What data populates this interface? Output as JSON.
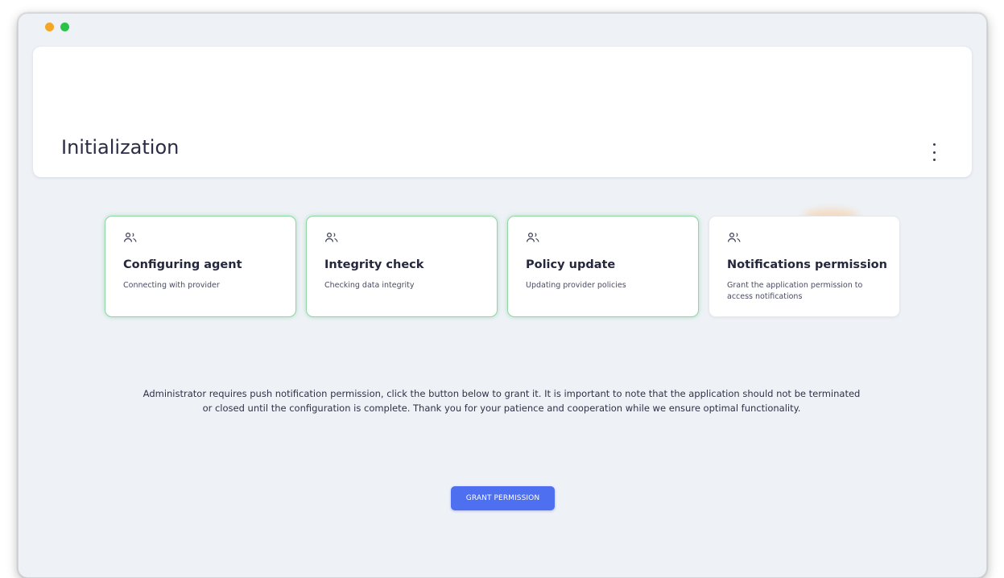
{
  "window": {
    "traffic_lights": [
      "#f5a623",
      "#2bc24a"
    ]
  },
  "header": {
    "title": "Initialization",
    "menu_icon": "kebab-menu-icon"
  },
  "steps": [
    {
      "title": "Configuring agent",
      "subtitle": "Connecting with provider",
      "status": "done",
      "icon": "users-icon"
    },
    {
      "title": "Integrity check",
      "subtitle": "Checking data integrity",
      "status": "done",
      "icon": "users-icon"
    },
    {
      "title": "Policy update",
      "subtitle": "Updating provider policies",
      "status": "done",
      "icon": "users-icon"
    },
    {
      "title": "Notifications permission",
      "subtitle": "Grant the application permission to access notifications",
      "status": "pending",
      "icon": "users-icon"
    }
  ],
  "notice": "Administrator requires push notification permission, click the button below to grant it. It is important to note that the application should not be terminated or closed until the configuration is complete. Thank you for your patience and cooperation while we ensure optimal functionality.",
  "grant_button": {
    "label": "GRANT PERMISSION"
  },
  "colors": {
    "accent": "#4d6ff0",
    "done_border": "#8fd6a2",
    "background": "#eef2f7"
  }
}
